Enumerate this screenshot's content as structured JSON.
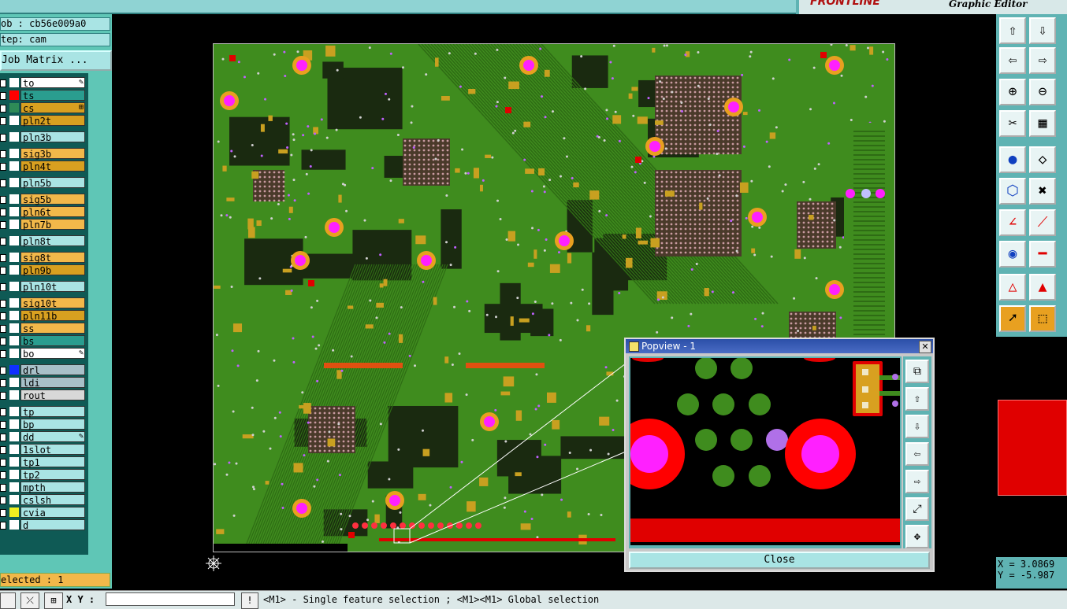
{
  "app": {
    "brand": "FRONTLINE",
    "subtitle": "Graphic Editor"
  },
  "left_panel": {
    "job": "ob : cb56e009a0",
    "step": "tep: cam",
    "job_matrix_button": "Job Matrix ...",
    "layers": [
      {
        "name": "to",
        "color": "#ffffff",
        "swatch": "#ffffff",
        "marker": "pencil"
      },
      {
        "name": "ts",
        "color": "#2a9d8f",
        "swatch": "#ff0000"
      },
      {
        "name": "cs",
        "color": "#d8a020",
        "swatch": "#2e8b57",
        "marker": "grid"
      },
      {
        "name": "pln2t",
        "color": "#d8a020",
        "swatch": "#ffffff"
      },
      {
        "name": "pln3b",
        "color": "#a9e4e4",
        "swatch": "#ffffff"
      },
      {
        "name": "sig3b",
        "color": "#f2b84a",
        "swatch": "#ffffff"
      },
      {
        "name": "pln4t",
        "color": "#d8a020",
        "swatch": "#ffffff"
      },
      {
        "name": "pln5b",
        "color": "#a9e4e4",
        "swatch": "#ffffff"
      },
      {
        "name": "sig5b",
        "color": "#f2b84a",
        "swatch": "#ffffff"
      },
      {
        "name": "pln6t",
        "color": "#f2b84a",
        "swatch": "#ffffff"
      },
      {
        "name": "pln7b",
        "color": "#f2b84a",
        "swatch": "#ffffff"
      },
      {
        "name": "pln8t",
        "color": "#a9e4e4",
        "swatch": "#ffffff"
      },
      {
        "name": "sig8t",
        "color": "#f2b84a",
        "swatch": "#ffffff"
      },
      {
        "name": "pln9b",
        "color": "#d8a020",
        "swatch": "#ffffff"
      },
      {
        "name": "pln10t",
        "color": "#a9e4e4",
        "swatch": "#ffffff"
      },
      {
        "name": "sig10t",
        "color": "#f2b84a",
        "swatch": "#ffffff"
      },
      {
        "name": "pln11b",
        "color": "#d8a020",
        "swatch": "#ffffff"
      },
      {
        "name": "ss",
        "color": "#f2b84a",
        "swatch": "#ffffff"
      },
      {
        "name": "bs",
        "color": "#2a9d8f",
        "swatch": "#ffffff"
      },
      {
        "name": "bo",
        "color": "#ffffff",
        "swatch": "#ffffff",
        "marker": "pencil"
      },
      {
        "name": "drl",
        "color": "#a8c0c8",
        "swatch": "#1030ff"
      },
      {
        "name": "ldi",
        "color": "#a8c0c8",
        "swatch": "#ffffff"
      },
      {
        "name": "rout",
        "color": "#d8d8d8",
        "swatch": "#ffffff"
      },
      {
        "name": "tp",
        "color": "#a9e4e4",
        "swatch": "#ffffff"
      },
      {
        "name": "bp",
        "color": "#a9e4e4",
        "swatch": "#ffffff"
      },
      {
        "name": "dd",
        "color": "#a9e4e4",
        "swatch": "#ffffff",
        "marker": "pencil"
      },
      {
        "name": "1slot",
        "color": "#a9e4e4",
        "swatch": "#ffffff"
      },
      {
        "name": "tp1",
        "color": "#a9e4e4",
        "swatch": "#ffffff"
      },
      {
        "name": "tp2",
        "color": "#a9e4e4",
        "swatch": "#ffffff"
      },
      {
        "name": "mpth",
        "color": "#a9e4e4",
        "swatch": "#ffffff"
      },
      {
        "name": "cslsh",
        "color": "#a9e4e4",
        "swatch": "#ffffff"
      },
      {
        "name": "cvia",
        "color": "#a9e4e4",
        "swatch": "#f0f020"
      },
      {
        "name": "d",
        "color": "#a9e4e4",
        "swatch": "#ffffff"
      }
    ],
    "selected": "elected : 1"
  },
  "popview": {
    "title": "Popview - 1",
    "close_label": "Close",
    "side_icons": [
      "zoom-window-icon",
      "pan-up-icon",
      "pan-down-icon",
      "pan-left-icon",
      "pan-right-icon",
      "zoom-fit-icon",
      "zoom-home-icon"
    ]
  },
  "right_toolbar": {
    "icons": [
      "pan-up-icon",
      "pan-down-icon",
      "pan-left-icon",
      "pan-right-icon",
      "zoom-in-icon",
      "zoom-out-icon",
      "measure-icon",
      "grid-icon",
      "snap-point-icon",
      "snap-shape-icon",
      "connect-icon",
      "cross-icon",
      "line-angle-icon",
      "line-diagonal-icon",
      "pad-icon",
      "line-horizontal-icon",
      "triangle-icon",
      "triangle-alt-icon",
      "select-pointer-icon",
      "select-box-icon"
    ],
    "coords": {
      "x": "X = 3.0869",
      "y": "Y = -5.987"
    }
  },
  "bottom_bar": {
    "xy_label": "X Y :",
    "xy_value": "",
    "status": "<M1> - Single feature selection ; <M1><M1> Global selection"
  }
}
